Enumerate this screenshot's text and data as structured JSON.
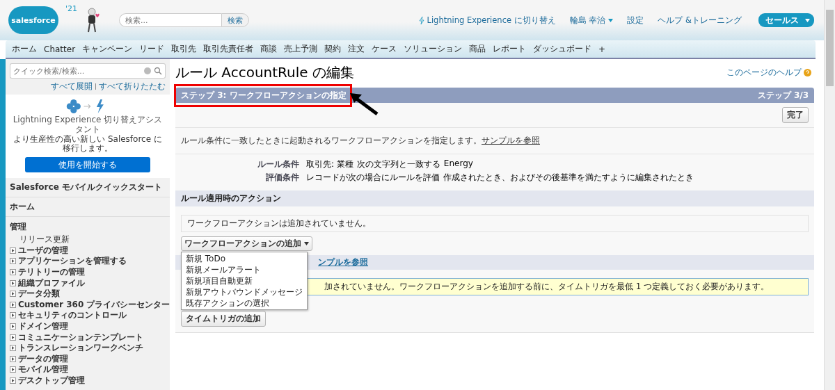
{
  "header": {
    "logo": "salesforce",
    "badge": "'21",
    "search": {
      "placeholder": "検索...",
      "button": "検索"
    },
    "links": [
      {
        "kind": "lightning",
        "label": "Lightning Experience に切り替え"
      },
      {
        "kind": "user",
        "label": "輪島 幸治"
      },
      {
        "kind": "plain",
        "label": "設定"
      },
      {
        "kind": "plain",
        "label": "ヘルプ &トレーニング"
      }
    ],
    "app_menu": "セールス"
  },
  "tabs": [
    {
      "label": "ホーム",
      "selected": false
    },
    {
      "label": "Chatter",
      "selected": false
    },
    {
      "label": "キャンペーン",
      "selected": false
    },
    {
      "label": "リード",
      "selected": false
    },
    {
      "label": "取引先",
      "selected": false
    },
    {
      "label": "取引先責任者",
      "selected": false
    },
    {
      "label": "商談",
      "selected": false
    },
    {
      "label": "売上予測",
      "selected": false
    },
    {
      "label": "契約",
      "selected": false
    },
    {
      "label": "注文",
      "selected": false
    },
    {
      "label": "ケース",
      "selected": false
    },
    {
      "label": "ソリューション",
      "selected": false
    },
    {
      "label": "商品",
      "selected": false
    },
    {
      "label": "レポート",
      "selected": false
    },
    {
      "label": "ダッシュボード",
      "selected": false
    },
    {
      "label": "+",
      "selected": false
    }
  ],
  "sidebar": {
    "search": {
      "placeholder": "クイック検索/検索..."
    },
    "expand_all": "すべて展開",
    "collapse_all": "すべて折りたたむ",
    "promo": {
      "title": "Lightning Experience 切り替えアシスタント",
      "text": "より生産性の高い新しい Salesforce に移行します。",
      "button": "使用を開始する"
    },
    "sections": [
      "Salesforce モバイルクイックスタート",
      "ホーム"
    ],
    "admin": {
      "title": "管理",
      "items": [
        {
          "kind": "link",
          "label": "リリース更新"
        },
        {
          "kind": "folder",
          "label": "ユーザの管理",
          "expanded": false
        },
        {
          "kind": "folder",
          "label": "アプリケーションを管理する",
          "expanded": false
        },
        {
          "kind": "folder",
          "label": "テリトリーの管理",
          "expanded": false
        },
        {
          "kind": "folder",
          "label": "組織プロファイル",
          "expanded": false
        },
        {
          "kind": "folder",
          "label": "データ分類",
          "expanded": false
        },
        {
          "kind": "folder",
          "label": "Customer 360 プライバシーセンター",
          "expanded": false
        },
        {
          "kind": "folder",
          "label": "セキュリティのコントロール",
          "expanded": false
        },
        {
          "kind": "folder",
          "label": "ドメイン管理",
          "expanded": false
        },
        {
          "kind": "folder",
          "label": "コミュニケーションテンプレート",
          "expanded": false
        },
        {
          "kind": "folder",
          "label": "トランスレーションワークベンチ",
          "expanded": false
        },
        {
          "kind": "folder",
          "label": "データの管理",
          "expanded": false
        },
        {
          "kind": "folder",
          "label": "モバイル管理",
          "expanded": false
        },
        {
          "kind": "folder",
          "label": "デスクトップ管理",
          "expanded": false
        }
      ]
    }
  },
  "page": {
    "title": "ルール AccountRule の編集",
    "help": "このページのヘルプ",
    "step": {
      "title": "ステップ 3: ワークフローアクションの指定",
      "counter": "ステップ 3/3",
      "button": "完了"
    },
    "description": "ルール条件に一致したときに起動されるワークフローアクションを指定します。",
    "description_link": "サンプルを参照",
    "details": [
      {
        "label": "ルール条件",
        "parts": [
          "取引先: 業種",
          "次の文字列と一致する",
          "Energy"
        ]
      },
      {
        "label": "評価条件",
        "parts": [
          "レコードが次の場合にルールを評価",
          "作成されたとき、およびその後基準を満たすように編集されたとき"
        ]
      }
    ],
    "immediate": {
      "title": "ルール適用時のアクション",
      "empty": "ワークフローアクションは追加されていません。",
      "add_button": "ワークフローアクションの追加",
      "menu": [
        "新規 ToDo",
        "新規メールアラート",
        "新規項目自動更新",
        "新規アウトバウンドメッセージ",
        "既存アクションの選択"
      ]
    },
    "time_triggered": {
      "link": "ンプルを参照",
      "notice": "加されていません。ワークフローアクションを追加する前に、タイムトリガを最低 1 つ定義しておく必要があります。",
      "button": "タイムトリガの追加"
    }
  }
}
